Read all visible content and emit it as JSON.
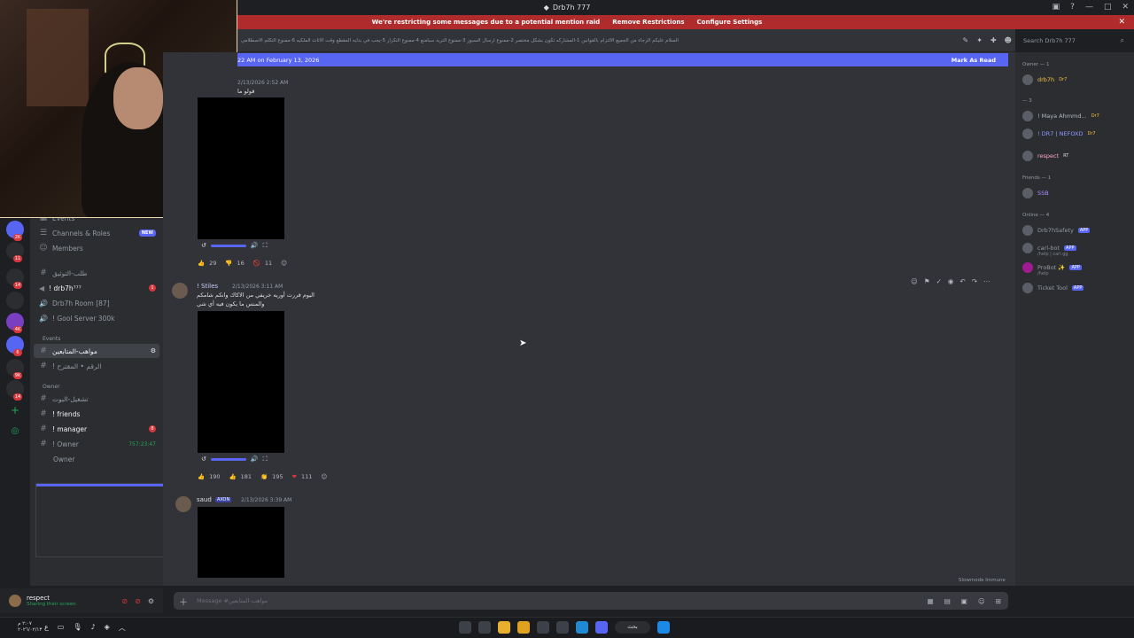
{
  "window": {
    "title": "Drb7h 777"
  },
  "notice": {
    "text": "We're restricting some messages due to a potential mention raid",
    "remove": "Remove Restrictions",
    "configure": "Configure Settings"
  },
  "header": {
    "topic": "السلام عليكم الرجاء من الجميع الالتزام بالقوانين 1-المشاركه تكون بشكل مختصر 2-ممنوع ارسال السبوز 3-ممنوع التريد سبامنع 4-ممنوع التكرار 5-يجب في بدايه المقطع وقت الاثات الملكيه 6-ممنوع التكلم الاصطلامي",
    "search_placeholder": "Search Drb7h 777"
  },
  "new_messages_bar": {
    "text": "22 AM on February 13, 2026",
    "mark_read": "Mark As Read"
  },
  "sidebar": {
    "events": "Events",
    "channels_roles": "Channels & Roles",
    "new_badge": "NEW",
    "members": "Members",
    "channels": [
      {
        "name": "طلب-التوثيق"
      },
      {
        "name": "! drb7h⁷⁷⁷",
        "badge": "1"
      },
      {
        "name": "Drb7h Room [87]"
      },
      {
        "name": "! Gool Server 300k"
      }
    ],
    "events_cat": "Events",
    "event_channels": [
      {
        "name": "مواهب-المتابعين"
      },
      {
        "name": "! الرقم • المقترح"
      }
    ],
    "owner_cat": "Owner",
    "owner_channels": [
      {
        "name": "تشغيل-البوت"
      },
      {
        "name": "! friends"
      },
      {
        "name": "! manager",
        "badge": "8"
      },
      {
        "name": "! Owner",
        "time": "757:23:47"
      },
      {
        "name": "Owner"
      }
    ]
  },
  "user_panel": {
    "name": "respect",
    "status": "Sharing their screen"
  },
  "messages": [
    {
      "timestamp": "2/13/2026 2:52 AM",
      "text": "قولو ما",
      "reactions": [
        {
          "icon": "👍",
          "count": "29"
        },
        {
          "icon": "👎",
          "count": "16"
        },
        {
          "icon": "🚫",
          "count": "11"
        }
      ]
    },
    {
      "author": "! Stiles",
      "timestamp": "2/13/2026 3:11 AM",
      "line1": "اليوم قررت أوريه خريفي من الاكاك وانكم شامكم",
      "line2": "والمنس ما يكون فيه أي شي",
      "reactions": [
        {
          "icon": "👍",
          "count": "190"
        },
        {
          "icon": "👍",
          "count": "181"
        },
        {
          "icon": "👏",
          "count": "195"
        },
        {
          "icon": "❤",
          "count": "111"
        }
      ]
    },
    {
      "author": "saud",
      "role": "AXON",
      "timestamp": "2/13/2026 3:39 AM"
    }
  ],
  "slowmode": "Slowmode Immune",
  "composer": {
    "placeholder": "Message #مواهب-المتابعين"
  },
  "member_list": {
    "owner_group": "Owner — 1",
    "owner": {
      "name": "drb7h",
      "tag": "Dr7"
    },
    "group3": "— 3",
    "m1": {
      "name": "! Maya Ahmmd...",
      "tag": "Dr7"
    },
    "m2": {
      "name": "! DR7 | NEFOXD",
      "tag": "Dr7"
    },
    "m3": {
      "name": "respect",
      "tag": "RT"
    },
    "friends_group": "Friends — 1",
    "f1": {
      "name": "SSB"
    },
    "online_group": "Online — 4",
    "o1": {
      "name": "Drb7hSafety",
      "tag": "APP"
    },
    "o2": {
      "name": "carl-bot",
      "tag": "APP",
      "sub": "/help | carl.gg"
    },
    "o3": {
      "name": "ProBot ✨",
      "tag": "APP",
      "sub": "/help"
    },
    "o4": {
      "name": "Ticket Tool",
      "tag": "APP"
    }
  },
  "taskbar": {
    "time": "٢:٠٧ م",
    "date": "٢٠٢٦/٠٢/١٣",
    "search": "بحث"
  }
}
